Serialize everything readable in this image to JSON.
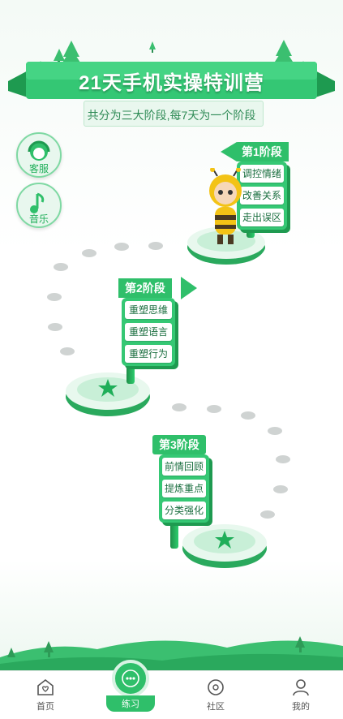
{
  "header": {
    "title": "21天手机实操特训营",
    "subtitle": "共分为三大阶段,每7天为一个阶段"
  },
  "side_buttons": [
    {
      "label": "客服",
      "icon": "customer-service-icon"
    },
    {
      "label": "音乐",
      "icon": "music-note-icon"
    }
  ],
  "stages": [
    {
      "flag": "第1阶段",
      "items": [
        "调控情绪",
        "改善关系",
        "走出误区"
      ],
      "mascot": "bee-mascot"
    },
    {
      "flag": "第2阶段",
      "items": [
        "重塑思维",
        "重塑语言",
        "重塑行为"
      ],
      "marker": "star-icon"
    },
    {
      "flag": "第3阶段",
      "items": [
        "前情回顾",
        "提炼重点",
        "分类强化"
      ],
      "marker": "star-icon"
    }
  ],
  "tabbar": {
    "items": [
      {
        "label": "首页",
        "icon": "home-heart-icon",
        "active": false
      },
      {
        "label": "练习",
        "icon": "practice-dots-icon",
        "active": true
      },
      {
        "label": "社区",
        "icon": "community-icon",
        "active": false
      },
      {
        "label": "我的",
        "icon": "user-icon",
        "active": false
      }
    ]
  },
  "colors": {
    "primary": "#2fbf6a",
    "primary_dark": "#1e9a50",
    "dot": "#cfd3d2",
    "tab_label": "#555555"
  }
}
